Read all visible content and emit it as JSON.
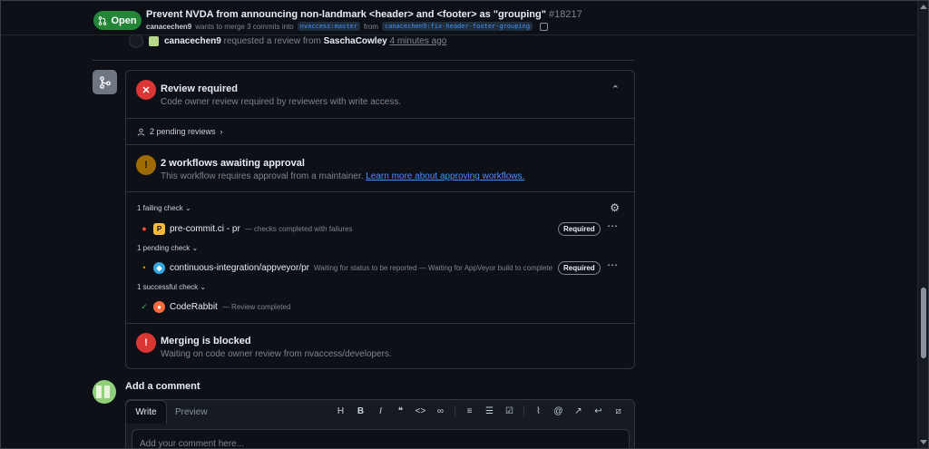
{
  "header": {
    "status": "Open",
    "title": "Prevent NVDA from announcing non-landmark <header> and <footer> as \"grouping\"",
    "number": "#18217",
    "author": "canacechen9",
    "merge_text": "wants to merge 3 commits into",
    "base_branch": "nvaccess:master",
    "from_text": "from",
    "head_branch": "canacechen9:fix-header-footer-grouping"
  },
  "timeline": {
    "author": "canacechen9",
    "action": "requested a review from",
    "reviewer": "SaschaCowley",
    "time": "4 minutes ago"
  },
  "review": {
    "title": "Review required",
    "desc": "Code owner review required by reviewers with write access.",
    "pending": "2 pending reviews"
  },
  "workflows": {
    "title": "2 workflows awaiting approval",
    "desc": "This workflow requires approval from a maintainer.",
    "link": "Learn more about approving workflows."
  },
  "checks": {
    "failing_label": "1 failing check",
    "pending_label": "1 pending check",
    "success_label": "1 successful check",
    "required_label": "Required",
    "items": [
      {
        "name": "pre-commit.ci - pr",
        "desc": "— checks completed with failures",
        "state": "failure"
      },
      {
        "name": "continuous-integration/appveyor/pr",
        "desc": "Waiting for status to be reported — Waiting for AppVeyor build to complete",
        "state": "pending"
      },
      {
        "name": "CodeRabbit",
        "desc": "— Review completed",
        "state": "success"
      }
    ]
  },
  "blocked": {
    "title": "Merging is blocked",
    "desc": "Waiting on code owner review from nvaccess/developers."
  },
  "comment": {
    "heading": "Add a comment",
    "tab_write": "Write",
    "tab_preview": "Preview",
    "placeholder": "Add your comment here..."
  },
  "colors": {
    "open": "#238636",
    "danger": "#da3633",
    "attention": "#9e6a03",
    "link": "#4493f8",
    "success": "#3fb950"
  }
}
